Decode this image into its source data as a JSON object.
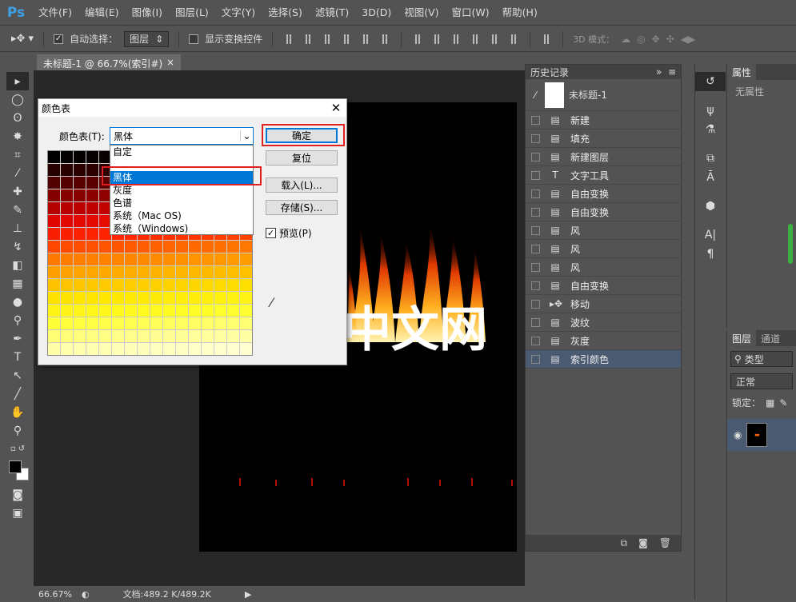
{
  "menubar": {
    "logo": "Ps",
    "items": [
      "文件(F)",
      "编辑(E)",
      "图像(I)",
      "图层(L)",
      "文字(Y)",
      "选择(S)",
      "滤镜(T)",
      "3D(D)",
      "视图(V)",
      "窗口(W)",
      "帮助(H)"
    ]
  },
  "options": {
    "auto_select_label": "自动选择：",
    "auto_select_value": "图层",
    "show_transform_label": "显示变换控件",
    "mode3d_label": "3D 模式："
  },
  "document": {
    "tab_title": "未标题-1 @ 66.7%(索引#) *",
    "tab_close": "×",
    "canvas_text": "中文网"
  },
  "status": {
    "zoom": "66.67%",
    "doc_info": "文档:489.2 K/489.2K"
  },
  "dialog": {
    "title": "颜色表",
    "close": "✕",
    "table_label": "颜色表(T):",
    "table_value": "黑体",
    "dropdown_options": [
      "自定",
      "",
      "黑体",
      "灰度",
      "色谱",
      "系统（Mac OS)",
      "系统（Windows)"
    ],
    "selected_option": "黑体",
    "buttons": {
      "ok": "确定",
      "reset": "复位",
      "load": "载入(L)...",
      "save": "存储(S)..."
    },
    "preview_label": "预览(P)",
    "preview_checked": true
  },
  "history": {
    "title": "历史记录",
    "snapshot": "未标题-1",
    "rows": [
      {
        "icon": "doc-icon",
        "label": "新建"
      },
      {
        "icon": "fill-icon",
        "label": "填充"
      },
      {
        "icon": "doc-icon",
        "label": "新建图层"
      },
      {
        "icon": "text-tool-icon",
        "label": "文字工具"
      },
      {
        "icon": "doc-icon",
        "label": "自由变换"
      },
      {
        "icon": "doc-icon",
        "label": "自由变换"
      },
      {
        "icon": "doc-icon",
        "label": "风"
      },
      {
        "icon": "doc-icon",
        "label": "风"
      },
      {
        "icon": "doc-icon",
        "label": "风"
      },
      {
        "icon": "doc-icon",
        "label": "自由变换"
      },
      {
        "icon": "move-icon",
        "label": "移动"
      },
      {
        "icon": "doc-icon",
        "label": "波纹"
      },
      {
        "icon": "doc-icon",
        "label": "灰度"
      },
      {
        "icon": "doc-icon",
        "label": "索引颜色"
      }
    ]
  },
  "properties": {
    "title": "属性",
    "empty": "无属性"
  },
  "layers": {
    "tab_layers": "图层",
    "tab_channels": "通道",
    "filter_kind": "类型",
    "blend_mode": "正常",
    "lock_label": "锁定："
  },
  "colors": {
    "accent": "#0078d7",
    "highlight_red": "#e02020"
  }
}
